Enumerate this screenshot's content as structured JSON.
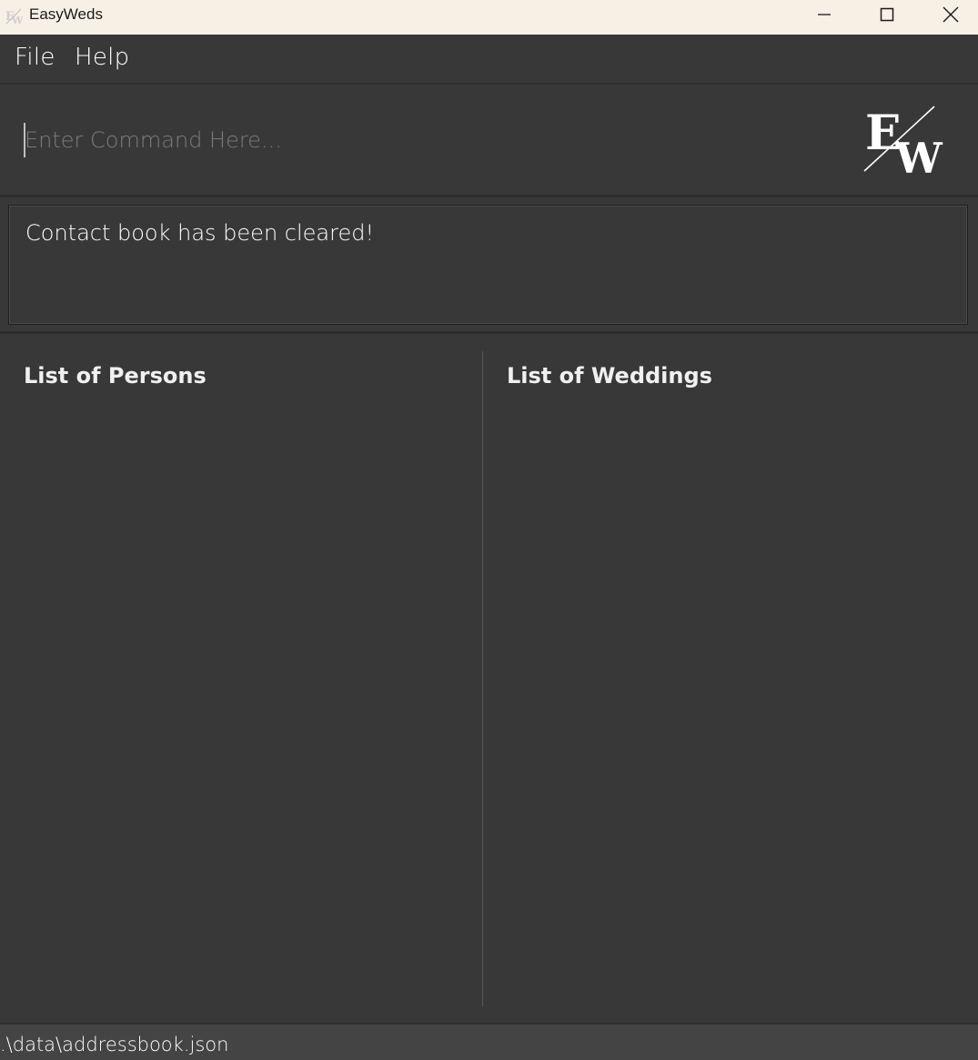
{
  "window": {
    "title": "EasyWeds"
  },
  "menu": {
    "file_label": "File",
    "help_label": "Help"
  },
  "command": {
    "placeholder": "Enter Command Here...",
    "value": ""
  },
  "result": {
    "message": "Contact book has been cleared!"
  },
  "persons_panel": {
    "title": "List of Persons",
    "items": []
  },
  "weddings_panel": {
    "title": "List of Weddings",
    "items": []
  },
  "status_bar": {
    "save_location": ".\\data\\addressbook.json"
  },
  "colors": {
    "titlebar_bg": "#f7f1e5",
    "app_bg": "#383838",
    "text": "#ffffff",
    "placeholder": "#7b7b7b",
    "statusbar_bg": "#444444"
  },
  "icons": {
    "app": "easyweds-logo-icon",
    "minimize": "minimize-icon",
    "maximize": "maximize-icon",
    "close": "close-icon",
    "logo": "easyweds-logo"
  }
}
